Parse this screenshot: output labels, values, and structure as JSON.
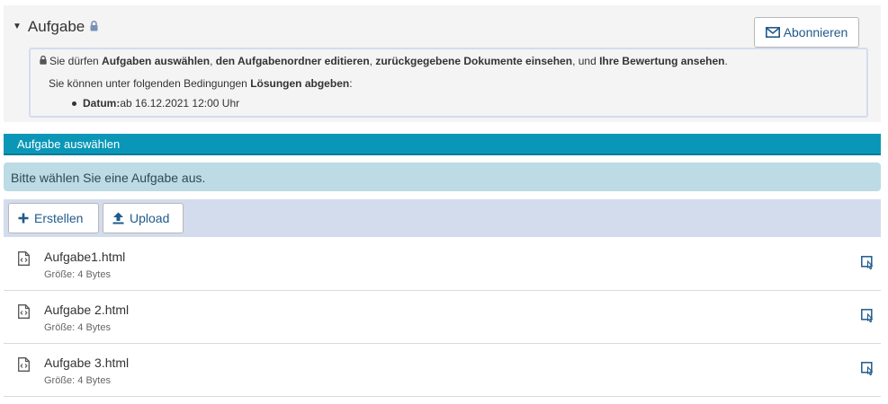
{
  "panel": {
    "title": "Aufgabe",
    "subscribe_label": "Abonnieren",
    "info": {
      "line1_prefix": "Sie dürfen ",
      "line1_b1": "Aufgaben auswählen",
      "line1_sep1": ", ",
      "line1_b2": "den Aufgabenordner editieren",
      "line1_sep2": ", ",
      "line1_b3": "zurückgegebene Dokumente einsehen",
      "line1_sep3": ", und ",
      "line1_b4": "Ihre Bewertung ansehen",
      "line1_end": ".",
      "line2_prefix": "Sie können unter folgenden Bedingungen ",
      "line2_bold": "Lösungen abgeben",
      "line2_end": ":",
      "date_label": "Datum:",
      "date_value": " ab 16.12.2021 12:00 Uhr"
    }
  },
  "section": {
    "title": "Aufgabe auswählen"
  },
  "alert": {
    "text": "Bitte wählen Sie eine Aufgabe aus."
  },
  "toolbar": {
    "create_label": "Erstellen",
    "upload_label": "Upload"
  },
  "files": [
    {
      "name": "Aufgabe1.html",
      "size": "Größe: 4 Bytes"
    },
    {
      "name": "Aufgabe 2.html",
      "size": "Größe: 4 Bytes"
    },
    {
      "name": "Aufgabe 3.html",
      "size": "Größe: 4 Bytes"
    }
  ],
  "colors": {
    "section_bar": "#0a97b7",
    "alert_bg": "#bcdbe4",
    "toolbar_bg": "#d3dcec",
    "link_blue": "#1f5a8c"
  }
}
